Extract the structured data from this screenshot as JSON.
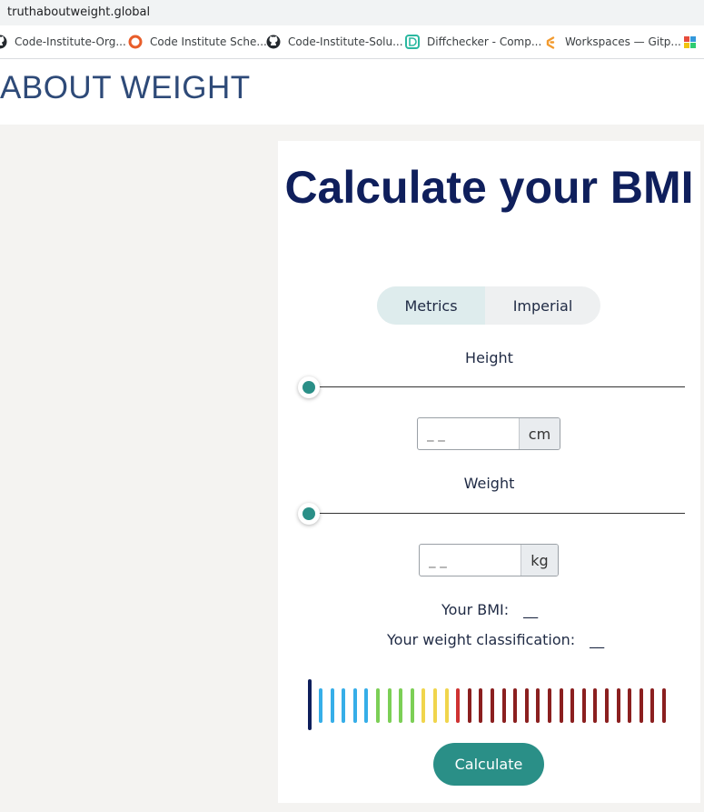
{
  "browser": {
    "url": "truthaboutweight.global",
    "bookmarks": [
      {
        "label": "Code-Institute-Org...",
        "icon": "github-icon"
      },
      {
        "label": "Code Institute Sche...",
        "icon": "code-institute-icon"
      },
      {
        "label": "Code-Institute-Solu...",
        "icon": "github-icon"
      },
      {
        "label": "Diffchecker - Comp...",
        "icon": "diffchecker-icon"
      },
      {
        "label": "Workspaces — Gitp...",
        "icon": "gitpod-icon"
      }
    ]
  },
  "header": {
    "title": "ABOUT WEIGHT"
  },
  "calculator": {
    "title": "Calculate your BMI",
    "tabs": [
      {
        "label": "Metrics",
        "active": true
      },
      {
        "label": "Imperial",
        "active": false
      }
    ],
    "height": {
      "label": "Height",
      "placeholder": "_ _",
      "unit": "cm",
      "slider_value": 0
    },
    "weight": {
      "label": "Weight",
      "placeholder": "_ _",
      "unit": "kg",
      "slider_value": 0
    },
    "bmi_label": "Your BMI:",
    "bmi_value": "__",
    "classification_label": "Your weight classification:",
    "classification_value": "__",
    "scale": {
      "colors": [
        "#0f1f5c",
        "#36aee8",
        "#36aee8",
        "#36aee8",
        "#36aee8",
        "#36aee8",
        "#7ccf56",
        "#7ccf56",
        "#7ccf56",
        "#7ccf56",
        "#f0d54c",
        "#f0d54c",
        "#f0d54c",
        "#cf3232",
        "#8b1f1f",
        "#8b1f1f",
        "#8b1f1f",
        "#8b1f1f",
        "#8b1f1f",
        "#8b1f1f",
        "#8b1f1f",
        "#8b1f1f",
        "#8b1f1f",
        "#8b1f1f",
        "#8b1f1f",
        "#8b1f1f",
        "#8b1f1f",
        "#8b1f1f",
        "#8b1f1f",
        "#8b1f1f",
        "#8b1f1f",
        "#8b1f1f"
      ]
    },
    "button_label": "Calculate"
  },
  "colors": {
    "accent": "#2a8f87",
    "title": "#0f1f5c",
    "brand": "#2e4a78"
  }
}
